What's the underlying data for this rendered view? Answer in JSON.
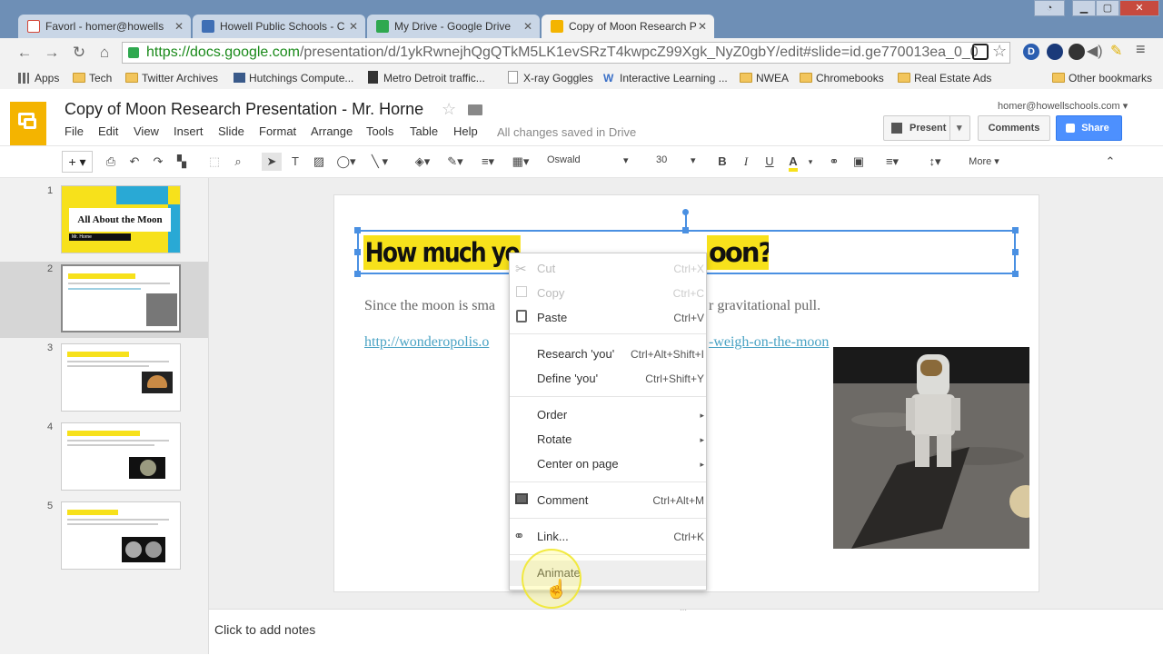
{
  "browser": {
    "tabs": [
      {
        "title": "Favorl - homer@howells",
        "icon_color": "#d44638"
      },
      {
        "title": "Howell Public Schools - C",
        "icon_color": "#3f6fb5"
      },
      {
        "title": "My Drive - Google Drive",
        "icon_color": "#2fa84f"
      },
      {
        "title": "Copy of Moon Research P",
        "icon_color": "#f4b400"
      }
    ],
    "url_host": "https://docs.google.com",
    "url_path": "/presentation/d/1ykRwnejhQgQTkM5LK1evSRzT4kwpcZ99Xgk_NyZ0gbY/edit#slide=id.ge770013ea_0_0",
    "bookmarks": [
      {
        "label": "Apps",
        "kind": "apps"
      },
      {
        "label": "Tech",
        "kind": "folder"
      },
      {
        "label": "Twitter Archives",
        "kind": "folder"
      },
      {
        "label": "Hutchings Compute...",
        "kind": "page"
      },
      {
        "label": "Metro Detroit traffic...",
        "kind": "page"
      },
      {
        "label": "X-ray Goggles",
        "kind": "page"
      },
      {
        "label": "Interactive Learning ...",
        "kind": "page"
      },
      {
        "label": "NWEA",
        "kind": "folder"
      },
      {
        "label": "Chromebooks",
        "kind": "folder"
      },
      {
        "label": "Real Estate Ads",
        "kind": "folder"
      },
      {
        "label": "Other bookmarks",
        "kind": "folder"
      }
    ]
  },
  "doc": {
    "title": "Copy of Moon Research Presentation - Mr. Horne",
    "menu": [
      "File",
      "Edit",
      "View",
      "Insert",
      "Slide",
      "Format",
      "Arrange",
      "Tools",
      "Table",
      "Help"
    ],
    "saved_status": "All changes saved in Drive",
    "user": "homer@howellschools.com",
    "present_label": "Present",
    "comments_label": "Comments",
    "share_label": "Share"
  },
  "toolbar": {
    "font": "Oswald",
    "size": "30",
    "more_label": "More"
  },
  "filmstrip": {
    "numbers": [
      "1",
      "2",
      "3",
      "4",
      "5"
    ],
    "slide1_title": "All About the Moon",
    "slide1_sub": "Mr. Horne"
  },
  "slide": {
    "title": "How much you weigh on the moon?",
    "title_visible_left": "How much yo",
    "title_visible_right": "oon?",
    "body_left": "Since the moon is sma",
    "body_right": "r gravitational pull.",
    "link_left": "http://wonderopolis.o",
    "link_right": "-weigh-on-the-moon"
  },
  "context_menu": {
    "items": [
      {
        "label": "Cut",
        "shortcut": "Ctrl+X",
        "disabled": true,
        "icon": "scissors-icon"
      },
      {
        "label": "Copy",
        "shortcut": "Ctrl+C",
        "disabled": true,
        "icon": "copy-icon"
      },
      {
        "label": "Paste",
        "shortcut": "Ctrl+V",
        "disabled": false,
        "icon": "paste-icon"
      },
      {
        "label": "Research 'you'",
        "shortcut": "Ctrl+Alt+Shift+I",
        "disabled": false
      },
      {
        "label": "Define 'you'",
        "shortcut": "Ctrl+Shift+Y",
        "disabled": false
      },
      {
        "label": "Order",
        "shortcut": "▸",
        "disabled": false
      },
      {
        "label": "Rotate",
        "shortcut": "▸",
        "disabled": false
      },
      {
        "label": "Center on page",
        "shortcut": "▸",
        "disabled": false
      },
      {
        "label": "Comment",
        "shortcut": "Ctrl+Alt+M",
        "disabled": false,
        "icon": "comment-icon"
      },
      {
        "label": "Link...",
        "shortcut": "Ctrl+K",
        "disabled": false,
        "icon": "link-icon"
      },
      {
        "label": "Animate",
        "shortcut": "",
        "disabled": false
      }
    ]
  },
  "notes_placeholder": "Click to add notes",
  "colors": {
    "slides_brand": "#f4b400",
    "title_highlight": "#f7e11b",
    "share_blue": "#4d90fe",
    "link_teal": "#4aa3c4",
    "thumb_cyan": "#29a9d5",
    "selection_blue": "#4a90e2"
  }
}
